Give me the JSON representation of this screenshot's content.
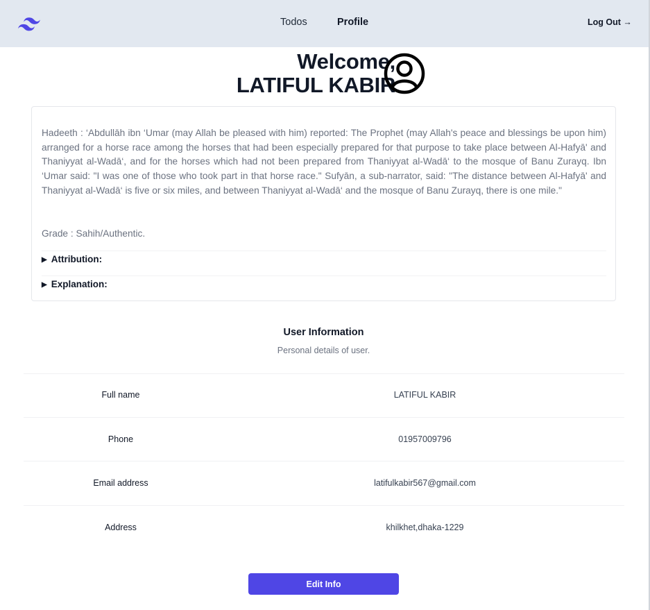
{
  "nav": {
    "logo": "tailwind-logo-icon",
    "todos": "Todos",
    "profile": "Profile",
    "logout": "Log Out →"
  },
  "welcome": {
    "line1": "Welcome,",
    "line2": "LATIFUL KABIR",
    "avatar_icon": "user-circle-icon"
  },
  "hadith": {
    "text": "Hadeeth : ‘Abdullāh ibn ‘Umar (may Allah be pleased with him) reported: The Prophet (may Allah's peace and blessings be upon him) arranged for a horse race among the horses that had been especially prepared for that purpose to take place between Al-Hafyā' and Thaniyyat al-Wadā‘, and for the horses which had not been prepared from Thaniyyat al-Wadā‘ to the mosque of Banu Zurayq. Ibn ‘Umar said: \"I was one of those who took part in that horse race.\" Sufyān, a sub-narrator, said: \"The distance between Al-Hafyā' and Thaniyyat al-Wadā‘ is five or six miles, and between Thaniyyat al-Wadā‘ and the mosque of Banu Zurayq, there is one mile.\"",
    "grade": "Grade : Sahih/Authentic.",
    "attribution": "Attribution:",
    "explanation": "Explanation:"
  },
  "user_info": {
    "title": "User Information",
    "subtitle": "Personal details of user.",
    "rows": [
      {
        "label": "Full name",
        "value": "LATIFUL KABIR"
      },
      {
        "label": "Phone",
        "value": "01957009796"
      },
      {
        "label": "Email address",
        "value": "latifulkabir567@gmail.com"
      },
      {
        "label": "Address",
        "value": "khilkhet,dhaka-1229"
      }
    ]
  },
  "edit_button": "Edit Info",
  "colors": {
    "navbar_bg": "#e2e8f0",
    "accent": "#4f46e5"
  }
}
